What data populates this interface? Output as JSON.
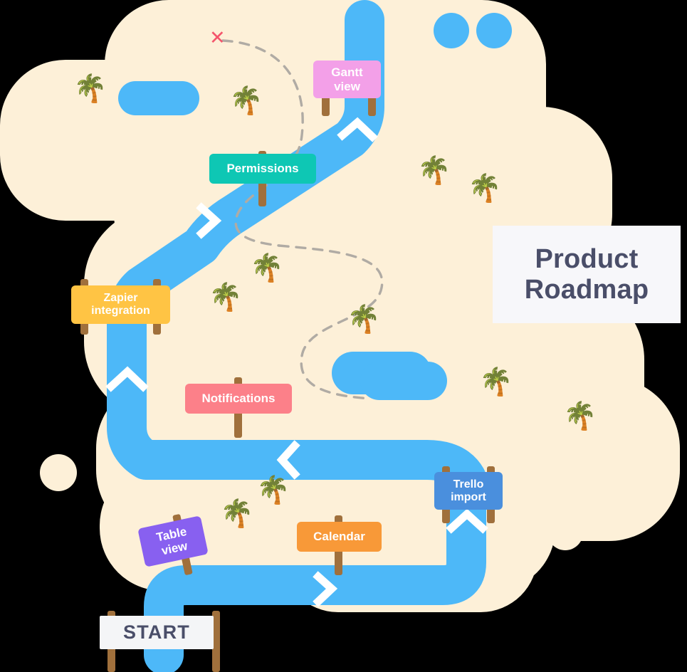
{
  "map": {
    "title_card": {
      "line1": "Product",
      "line2": "Roadmap"
    },
    "colors": {
      "background": "#000000",
      "land": "#fdf0d8",
      "water": "#4db8f8",
      "trail": "#b0aba4",
      "marker_x": "#f4556b",
      "post": "#a0703c",
      "title_text": "#4a4e69",
      "title_panel": "#f7f7fa"
    },
    "marker": {
      "name": "red-x-marker",
      "glyph": "✕"
    },
    "start": {
      "label": "START",
      "color": "#f4f5f7",
      "text_color": "#4a4e69"
    },
    "signposts": [
      {
        "label_line1": "Gantt",
        "label_line2": "view",
        "color": "#f3a0e8",
        "posts": 2,
        "rotate": 0
      },
      {
        "label_line1": "Permissions",
        "label_line2": "",
        "color": "#0ec7b4",
        "posts": 1,
        "rotate": 0
      },
      {
        "label_line1": "Zapier",
        "label_line2": "integration",
        "color": "#ffc444",
        "posts": 2,
        "rotate": 0
      },
      {
        "label_line1": "Notifications",
        "label_line2": "",
        "color": "#fc8089",
        "posts": 1,
        "rotate": 0
      },
      {
        "label_line1": "Trello",
        "label_line2": "import",
        "color": "#4a8fdd",
        "posts": 2,
        "rotate": 0
      },
      {
        "label_line1": "Table",
        "label_line2": "view",
        "color": "#8860f0",
        "posts": 1,
        "rotate": -12
      },
      {
        "label_line1": "Calendar",
        "label_line2": "",
        "color": "#f89938",
        "posts": 1,
        "rotate": 0
      }
    ],
    "palm_glyph": "🌴",
    "palm_count": 12
  }
}
